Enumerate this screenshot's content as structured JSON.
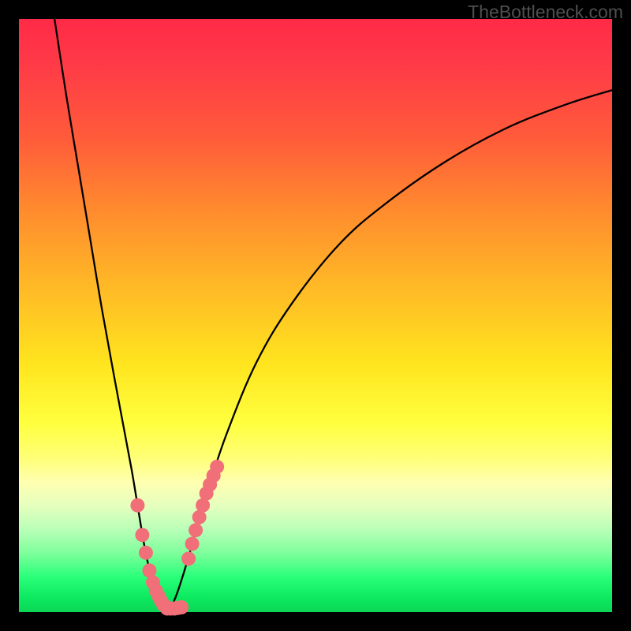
{
  "watermark": "TheBottleneck.com",
  "chart_data": {
    "type": "line",
    "title": "",
    "xlabel": "",
    "ylabel": "",
    "xlim": [
      0,
      100
    ],
    "ylim": [
      0,
      100
    ],
    "series": [
      {
        "name": "left-branch",
        "x": [
          6,
          8,
          10,
          12,
          14,
          16,
          17.5,
          19,
          20,
          21,
          21.8,
          22.6,
          23.2,
          23.8,
          24.4,
          25
        ],
        "y": [
          100,
          87,
          75,
          63,
          51,
          40,
          32,
          24,
          18,
          12,
          8,
          5,
          3,
          2,
          1,
          0.5
        ]
      },
      {
        "name": "right-branch",
        "x": [
          25,
          25.8,
          26.6,
          27.6,
          28.8,
          30.2,
          32,
          35,
          40,
          46,
          54,
          62,
          72,
          82,
          92,
          100
        ],
        "y": [
          0.5,
          1.2,
          3,
          6,
          10,
          15,
          21,
          30,
          42,
          52,
          62,
          69,
          76,
          81.5,
          85.5,
          88
        ]
      },
      {
        "name": "left-markers",
        "x": [
          20.0,
          20.8,
          21.4,
          22.0,
          22.6,
          23.1,
          23.6,
          24.0,
          24.4,
          25.0,
          25.6,
          26.2,
          26.8,
          27.4
        ],
        "y": [
          18.0,
          13.0,
          10.0,
          7.0,
          5.0,
          3.6,
          2.6,
          1.8,
          1.2,
          0.6,
          0.6,
          0.6,
          0.7,
          0.8
        ]
      },
      {
        "name": "right-markers",
        "x": [
          28.6,
          29.2,
          29.8,
          30.4,
          31.0,
          31.6,
          32.2,
          32.8,
          33.4
        ],
        "y": [
          9.0,
          11.5,
          13.8,
          16.0,
          18.0,
          20.0,
          21.5,
          23.0,
          24.5
        ]
      }
    ],
    "marker_color": "#f06f78",
    "curve_color": "#000000"
  }
}
